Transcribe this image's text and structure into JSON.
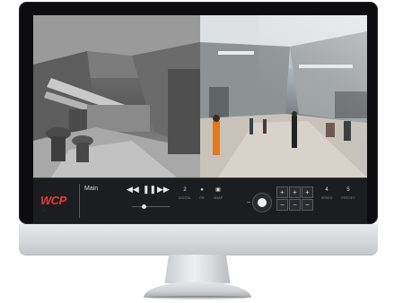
{
  "brand": {
    "top": "...",
    "name": "WCP",
    "sub": "..."
  },
  "view": {
    "name": "Main",
    "sub": ""
  },
  "playback": {
    "prev_icon": "skip-back-icon",
    "pause_icon": "pause-icon",
    "next_icon": "skip-forward-icon"
  },
  "controls": [
    {
      "value": "2",
      "label": "DIGITAL"
    },
    {
      "value": "●",
      "label": "PR"
    },
    {
      "value": "▣",
      "label": "SNAP"
    }
  ],
  "ptz": {
    "preset_buttons": [
      "+",
      "+",
      "+",
      "−",
      "−",
      "−"
    ],
    "speed": {
      "value": "4",
      "label": "SPEED"
    },
    "preset": {
      "value": "5",
      "label": "PRESET"
    }
  },
  "colors": {
    "accent": "#e23b3b",
    "bar": "#1c1d20",
    "bezel": "#0d0d0f"
  }
}
